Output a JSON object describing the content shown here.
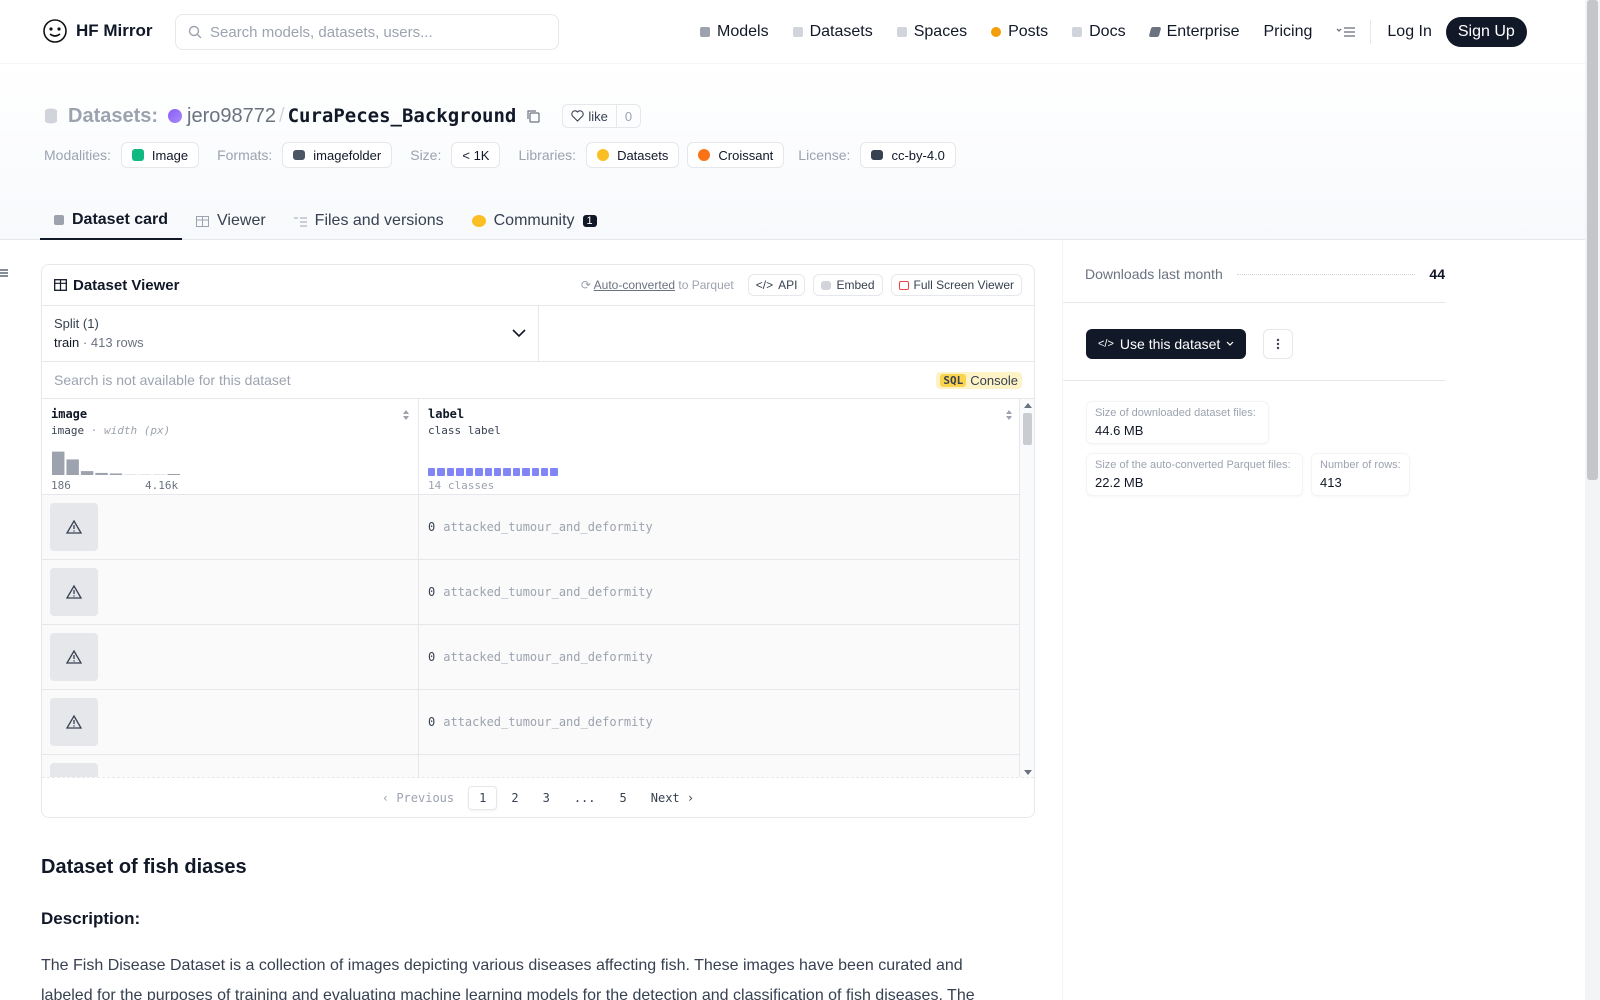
{
  "brand": {
    "name": "HF Mirror"
  },
  "search": {
    "placeholder": "Search models, datasets, users..."
  },
  "nav": {
    "items": [
      {
        "label": "Models",
        "color": "#9ca3af"
      },
      {
        "label": "Datasets",
        "color": "#d1d5db"
      },
      {
        "label": "Spaces",
        "color": "#d1d5db"
      },
      {
        "label": "Posts",
        "color": "#f59e0b"
      },
      {
        "label": "Docs",
        "color": "#d1d5db"
      },
      {
        "label": "Enterprise",
        "color": "#6b7280"
      },
      {
        "label": "Pricing",
        "color": ""
      }
    ],
    "login": "Log In",
    "signup": "Sign Up"
  },
  "repo": {
    "type": "Datasets:",
    "owner": "jero98772",
    "slash": "/",
    "name": "CuraPeces_Background",
    "like_label": "like",
    "like_count": "0"
  },
  "tags": {
    "modalities_label": "Modalities:",
    "modalities": "Image",
    "formats_label": "Formats:",
    "formats": "imagefolder",
    "size_label": "Size:",
    "size": "< 1K",
    "libraries_label": "Libraries:",
    "libraries": [
      "Datasets",
      "Croissant"
    ],
    "license_label": "License:",
    "license": "cc-by-4.0"
  },
  "tabs": [
    {
      "label": "Dataset card"
    },
    {
      "label": "Viewer"
    },
    {
      "label": "Files and versions"
    },
    {
      "label": "Community",
      "badge": "1"
    }
  ],
  "viewer": {
    "title": "Dataset Viewer",
    "auto_converted": "Auto-converted",
    "to_parquet": " to Parquet",
    "api": "API",
    "embed": "Embed",
    "full_screen": "Full Screen Viewer",
    "split_label": "Split (1)",
    "split_name": "train",
    "split_sep": "·",
    "split_rows": "413 rows",
    "search_placeholder": "Search is not available for this dataset",
    "sql": "SQL",
    "console": "Console",
    "columns": {
      "image": {
        "name": "image",
        "type": "image",
        "sub": "· width (px)",
        "min": "186",
        "max": "4.16k",
        "hist": [
          0.9,
          0.6,
          0.15,
          0.08,
          0.06,
          0,
          0,
          0,
          0.04
        ]
      },
      "label": {
        "name": "label",
        "type": "class label",
        "classes": "14 classes"
      }
    },
    "rows": [
      {
        "idx": "0",
        "cls": "attacked_tumour_and_deformity"
      },
      {
        "idx": "0",
        "cls": "attacked_tumour_and_deformity"
      },
      {
        "idx": "0",
        "cls": "attacked_tumour_and_deformity"
      },
      {
        "idx": "0",
        "cls": "attacked_tumour_and_deformity"
      }
    ],
    "pager": {
      "prev": "Previous",
      "pages": [
        "1",
        "2",
        "3",
        "...",
        "5"
      ],
      "next": "Next"
    }
  },
  "card": {
    "h2": "Dataset of fish diases",
    "h3": "Description:",
    "para": "The Fish Disease Dataset is a collection of images depicting various diseases affecting fish. These images have been curated and labeled for the purposes of training and evaluating machine learning models for the detection and classification of fish diseases. The"
  },
  "sidebar": {
    "downloads_label": "Downloads last month",
    "downloads": "44",
    "use_dataset": "Use this dataset",
    "stats": [
      {
        "label": "Size of downloaded dataset files:",
        "value": "44.6 MB"
      },
      {
        "label": "Size of the auto-converted Parquet files:",
        "value": "22.2 MB"
      },
      {
        "label": "Number of rows:",
        "value": "413"
      }
    ]
  }
}
